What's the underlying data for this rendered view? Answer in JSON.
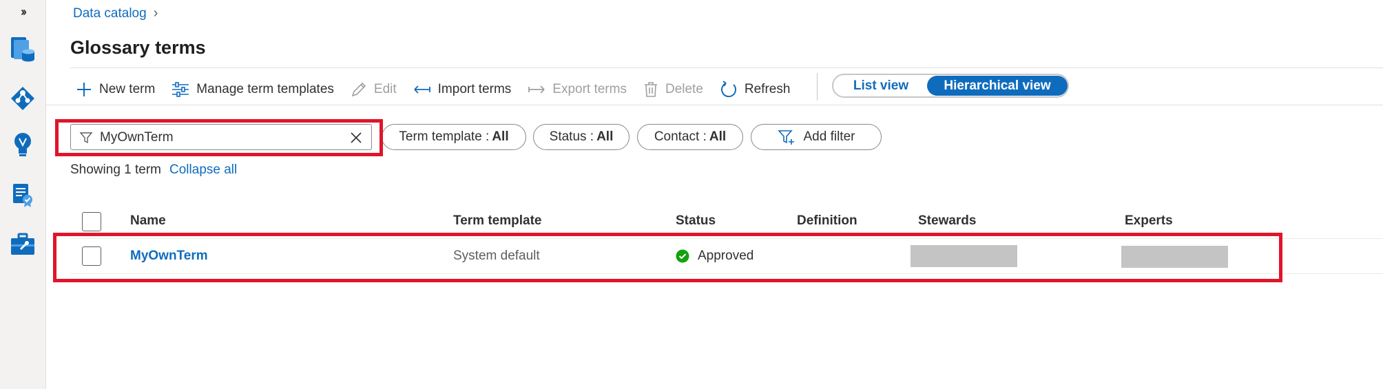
{
  "breadcrumb": {
    "root": "Data catalog",
    "separator": "›"
  },
  "page": {
    "title": "Glossary terms"
  },
  "toolbar": {
    "new_term": "New term",
    "manage_templates": "Manage term templates",
    "edit": "Edit",
    "import_terms": "Import terms",
    "export_terms": "Export terms",
    "delete": "Delete",
    "refresh": "Refresh",
    "list_view": "List view",
    "hierarchical_view": "Hierarchical view"
  },
  "filters": {
    "search_value": "MyOwnTerm",
    "term_template": {
      "label": "Term template :",
      "value": "All"
    },
    "status": {
      "label": "Status :",
      "value": "All"
    },
    "contact": {
      "label": "Contact :",
      "value": "All"
    },
    "add_filter": "Add filter"
  },
  "results": {
    "showing": "Showing 1 term",
    "collapse_all": "Collapse all"
  },
  "table": {
    "headers": {
      "name": "Name",
      "term_template": "Term template",
      "status": "Status",
      "definition": "Definition",
      "stewards": "Stewards",
      "experts": "Experts"
    },
    "rows": [
      {
        "name": "MyOwnTerm",
        "term_template": "System default",
        "status": "Approved",
        "definition": ""
      }
    ]
  },
  "colors": {
    "accent": "#0f6cbd",
    "approved": "#13a10e",
    "annotation": "#e0152b",
    "redaction": "#c4c4c4"
  }
}
